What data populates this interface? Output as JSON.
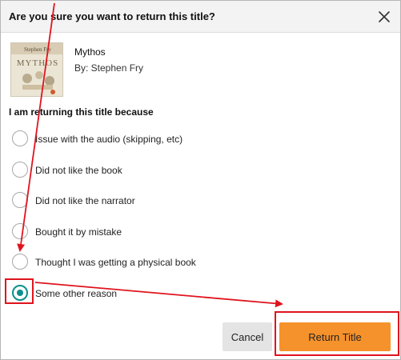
{
  "dialog": {
    "title": "Are you sure you want to return this title?",
    "close_icon": "close-icon"
  },
  "book": {
    "title": "Mythos",
    "author": "By: Stephen Fry",
    "cover_author": "Stephen Fry",
    "cover_title": "MYTHOS"
  },
  "reasons": {
    "label": "I am returning this title because",
    "options": [
      {
        "label": "Issue with the audio (skipping, etc)",
        "selected": false
      },
      {
        "label": "Did not like the book",
        "selected": false
      },
      {
        "label": "Did not like the narrator",
        "selected": false
      },
      {
        "label": "Bought it by mistake",
        "selected": false
      },
      {
        "label": "Thought I was getting a physical book",
        "selected": false
      },
      {
        "label": "Some other reason",
        "selected": true
      }
    ]
  },
  "actions": {
    "cancel_label": "Cancel",
    "return_label": "Return Title"
  },
  "colors": {
    "accent_teal": "#0a8f8c",
    "primary_button": "#f6922c",
    "annotation_red": "#e0141e"
  }
}
